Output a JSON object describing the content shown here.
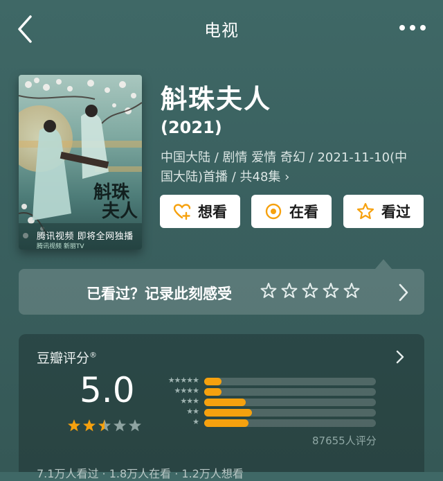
{
  "nav": {
    "title": "电视"
  },
  "poster": {
    "caption": "腾讯视频 即将全网独播",
    "logos": "腾讯视频  新丽TV"
  },
  "show": {
    "title": "斛珠夫人",
    "year": "(2021)",
    "meta_line1": "中国大陆 / 剧情 爱情 奇幻 / 2021-11-10(中",
    "meta_line2": "国大陆)首播 / 共48集 ›"
  },
  "actions": {
    "want": "想看",
    "watching": "在看",
    "watched": "看过"
  },
  "record": {
    "prompt": "已看过？记录此刻感受",
    "stars_count": 5
  },
  "rating": {
    "label": "豆瓣评分",
    "reg": "®",
    "score": "5.0",
    "score_stars": 2.5,
    "distribution": [
      {
        "stars": "★★★★★",
        "fraction": 0.1
      },
      {
        "stars": "★★★★",
        "fraction": 0.1
      },
      {
        "stars": "★★★",
        "fraction": 0.24
      },
      {
        "stars": "★★",
        "fraction": 0.28
      },
      {
        "stars": "★",
        "fraction": 0.26
      }
    ],
    "count": "87655人评分",
    "summary": "7.1万人看过 · 1.8万人在看 · 1.2万人想看"
  },
  "colors": {
    "accent": "#f6a10e",
    "background": "#3f6866"
  }
}
